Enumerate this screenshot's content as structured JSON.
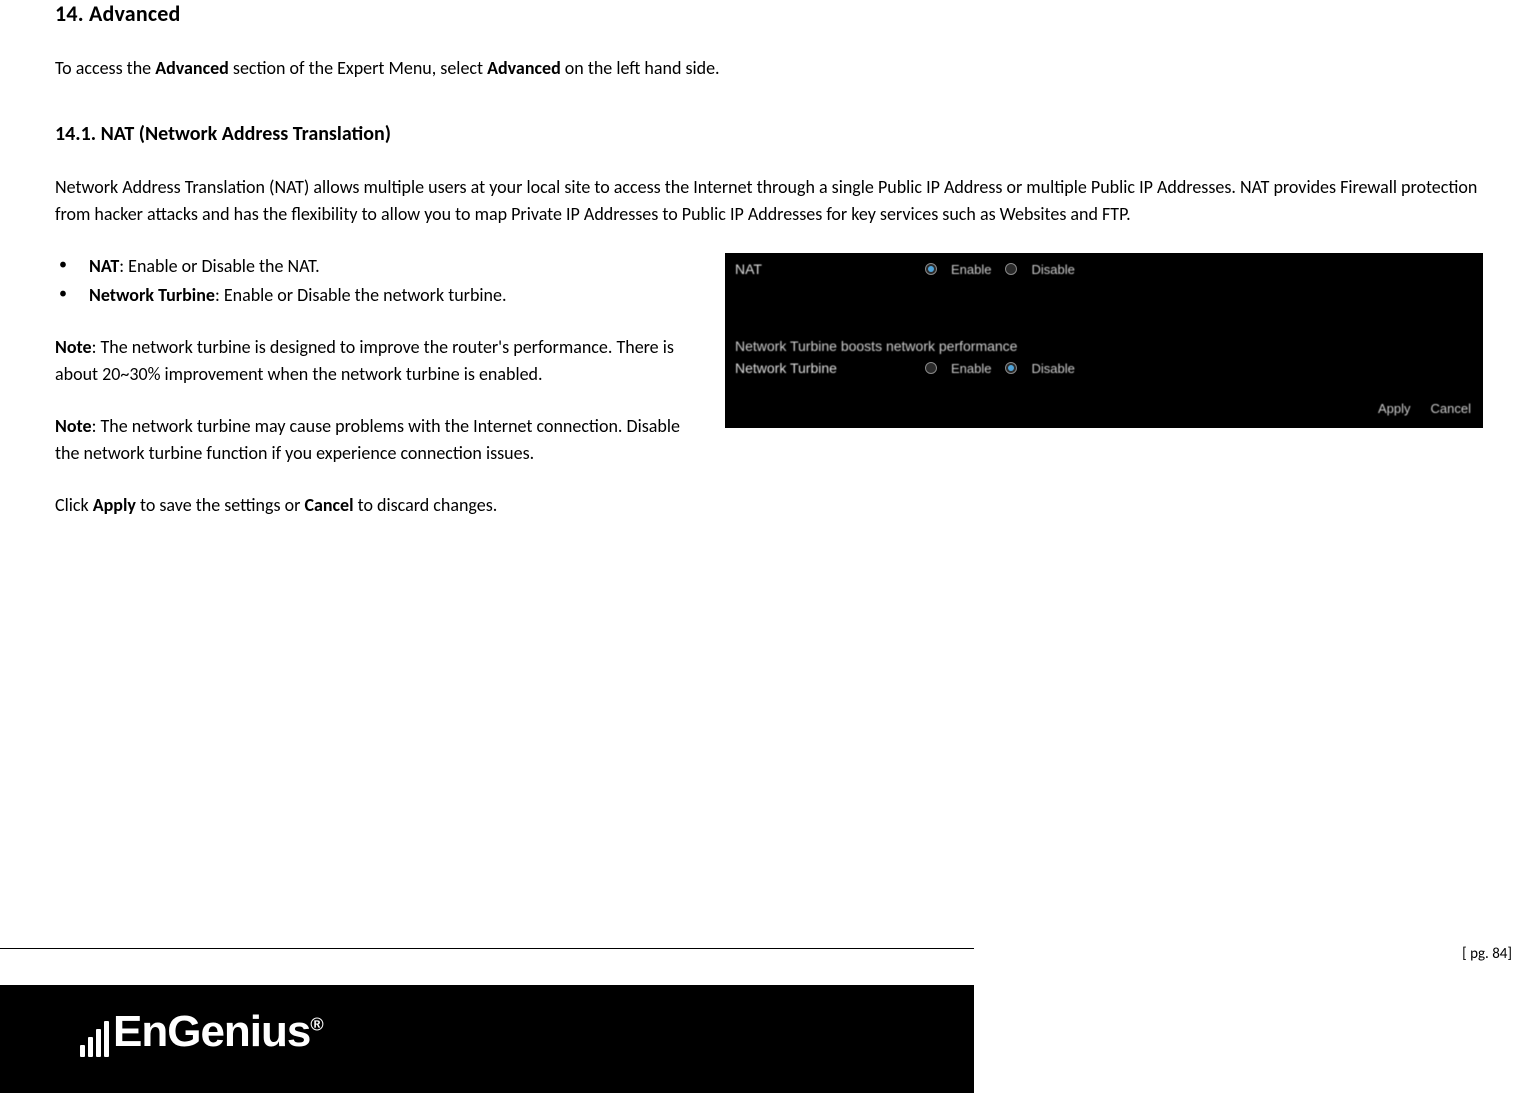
{
  "heading1": "14. Advanced",
  "intro_prefix": "To access the ",
  "intro_bold1": "Advanced",
  "intro_mid": " section of the Expert Menu, select ",
  "intro_bold2": "Advanced",
  "intro_suffix": " on the left hand side.",
  "heading2": "14.1.  NAT (Network Address Translation)",
  "desc": "Network Address Translation (NAT) allows multiple users at your local site to access the Internet through a single Public IP Address or multiple Public IP Addresses. NAT provides Firewall protection from hacker attacks and has the flexibility to allow you to map Private IP Addresses to Public IP Addresses for key services such as Websites and FTP.",
  "bullets": [
    {
      "bold": "NAT",
      "rest": ": Enable or Disable the NAT."
    },
    {
      "bold": "Network Turbine",
      "rest": ": Enable or Disable the network turbine."
    }
  ],
  "note1_bold": "Note",
  "note1_rest": ": The network turbine is designed to improve the router's performance. There is about 20~30% improvement when the network turbine is enabled.",
  "note2_bold": "Note",
  "note2_rest": ": The network turbine may cause problems with the Internet connection. Disable the network turbine function if you experience connection issues.",
  "clickline_pre": "Click ",
  "clickline_apply": "Apply",
  "clickline_mid": " to save the settings or ",
  "clickline_cancel": "Cancel",
  "clickline_post": " to discard changes.",
  "screenshot": {
    "nat_label": "NAT",
    "enable": "Enable",
    "disable": "Disable",
    "boost_text": "Network Turbine boosts network performance",
    "turbine_label": "Network Turbine",
    "apply": "Apply",
    "cancel": "Cancel"
  },
  "page_number": "[ pg. 84]",
  "logo_text": "EnGenius",
  "logo_reg": "®"
}
